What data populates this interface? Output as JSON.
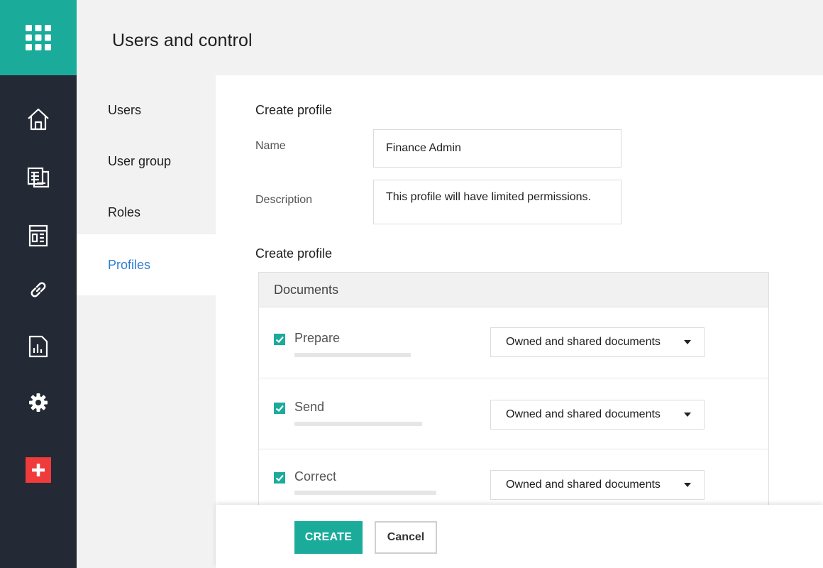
{
  "colors": {
    "accent": "#1aab9b",
    "rail_bg": "#232a35",
    "active_link": "#2f7fd1",
    "danger": "#ef3b3b"
  },
  "rail": {
    "items": [
      {
        "icon": "apps-grid-icon"
      },
      {
        "icon": "home-icon"
      },
      {
        "icon": "documents-icon"
      },
      {
        "icon": "templates-icon"
      },
      {
        "icon": "link-icon"
      },
      {
        "icon": "reports-icon"
      },
      {
        "icon": "gear-icon"
      },
      {
        "icon": "add-icon"
      }
    ]
  },
  "header": {
    "title": "Users and control"
  },
  "subnav": {
    "items": [
      {
        "label": "Users"
      },
      {
        "label": "User group"
      },
      {
        "label": "Roles"
      },
      {
        "label": "Profiles"
      }
    ],
    "active": "Profiles"
  },
  "form": {
    "section_title": "Create profile",
    "name_label": "Name",
    "name_value": "Finance Admin",
    "description_label": "Description",
    "description_value": "This profile will have limited permissions."
  },
  "permissions": {
    "section_title": "Create profile",
    "group_title": "Documents",
    "rows": [
      {
        "label": "Prepare",
        "checked": true,
        "option": "Owned and shared documents"
      },
      {
        "label": "Send",
        "checked": true,
        "option": "Owned and shared documents"
      },
      {
        "label": "Correct",
        "checked": true,
        "option": "Owned and shared documents"
      }
    ]
  },
  "footer": {
    "create_label": "CREATE",
    "cancel_label": "Cancel"
  }
}
